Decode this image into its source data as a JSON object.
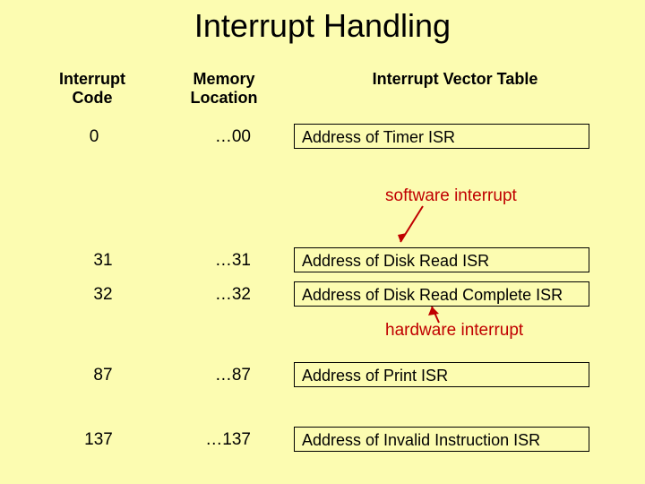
{
  "title": "Interrupt Handling",
  "headers": {
    "code": "Interrupt\nCode",
    "mem": "Memory\nLocation",
    "ivt": "Interrupt Vector Table"
  },
  "rows": [
    {
      "code": "0",
      "mem": "…00",
      "addr": "Address of Timer ISR"
    },
    {
      "code": "31",
      "mem": "…31",
      "addr": "Address of Disk Read ISR"
    },
    {
      "code": "32",
      "mem": "…32",
      "addr": "Address of Disk Read Complete ISR"
    },
    {
      "code": "87",
      "mem": "…87",
      "addr": "Address of Print ISR"
    },
    {
      "code": "137",
      "mem": "…137",
      "addr": "Address of Invalid Instruction ISR"
    }
  ],
  "annotations": {
    "software": "software interrupt",
    "hardware": "hardware interrupt"
  }
}
